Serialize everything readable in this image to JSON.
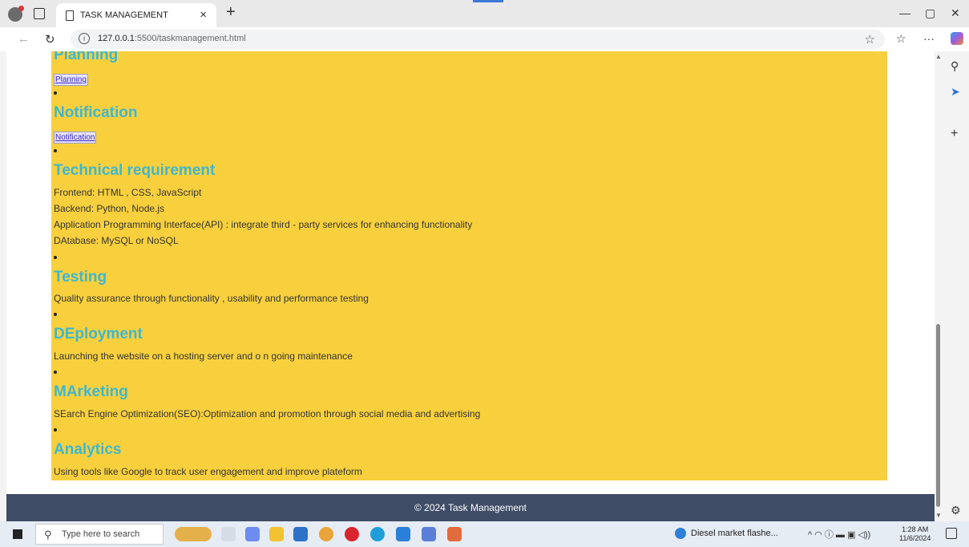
{
  "browser": {
    "tab_title": "TASK MANAGEMENT",
    "url_host": "127.0.0.1",
    "url_path": ":5500/taskmanagement.html"
  },
  "sections": [
    {
      "heading": "Planning",
      "link": "Planning"
    },
    {
      "heading": "Notification",
      "link": "Notification"
    },
    {
      "heading": "Technical requirement",
      "lines": [
        "Frontend: HTML , CSS, JavaScript",
        "Backend: Python, Node.js",
        "Application Programming Interface(API) : integrate third - party services for enhancing functionality",
        "DAtabase: MySQL or NoSQL"
      ]
    },
    {
      "heading": "Testing",
      "lines": [
        "Quality assurance through functionality , usability and performance testing"
      ]
    },
    {
      "heading": "DEployment",
      "lines": [
        "Launching the website on a hosting server and o n going maintenance"
      ]
    },
    {
      "heading": "MArketing",
      "lines": [
        "SEarch Engine Optimization(SEO):Optimization and promotion through social media and advertising"
      ]
    },
    {
      "heading": "Analytics",
      "lines": [
        "Using tools like Google to track user engagement and improve plateform"
      ]
    }
  ],
  "footer": {
    "text": "© 2024 Task Management"
  },
  "taskbar": {
    "search_placeholder": "Type here to search",
    "news": "Diesel market flashe...",
    "time": "1:28 AM",
    "date": "11/6/2024"
  }
}
